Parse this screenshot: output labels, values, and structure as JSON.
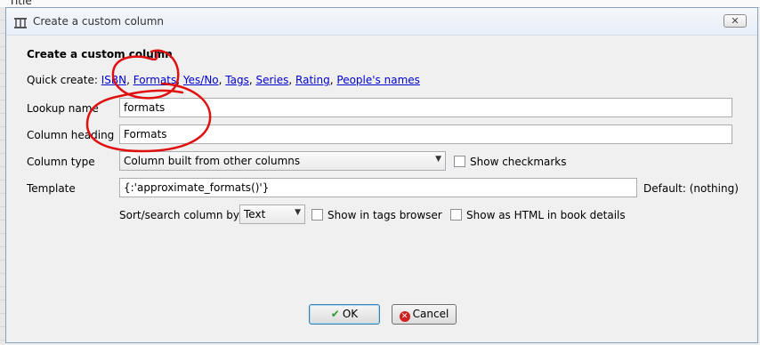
{
  "background": {
    "partial_title": "Title"
  },
  "window": {
    "title": "Create a custom column",
    "close_glyph": "✕"
  },
  "form": {
    "heading": "Create a custom column",
    "quick_create": {
      "label": "Quick create: ",
      "links": [
        "ISBN",
        "Formats",
        "Yes/No",
        "Tags",
        "Series",
        "Rating",
        "People's names"
      ]
    },
    "lookup_name": {
      "label": "Lookup name",
      "value": "formats"
    },
    "column_heading": {
      "label": "Column heading",
      "value": "Formats"
    },
    "column_type": {
      "label": "Column type",
      "value": "Column built from other columns"
    },
    "show_checkmarks": {
      "label": "Show checkmarks",
      "checked": false
    },
    "template": {
      "label": "Template",
      "value": "{:'approximate_formats()'}",
      "default_text": "Default: (nothing)"
    },
    "sort_search": {
      "label": "Sort/search column by",
      "value": "Text"
    },
    "show_in_tags_browser": {
      "label": "Show in tags browser",
      "checked": false
    },
    "show_as_html": {
      "label": "Show as HTML in book details",
      "checked": false
    }
  },
  "buttons": {
    "ok": "OK",
    "cancel": "Cancel"
  },
  "colors": {
    "link": "#0000cc",
    "annotation": "#e01010",
    "ok_check": "#2e9b2e",
    "cancel_icon": "#d12020"
  },
  "icons": [
    "app-icon",
    "close-icon",
    "dropdown-arrow-icon",
    "checkmark-icon",
    "cancel-icon"
  ]
}
